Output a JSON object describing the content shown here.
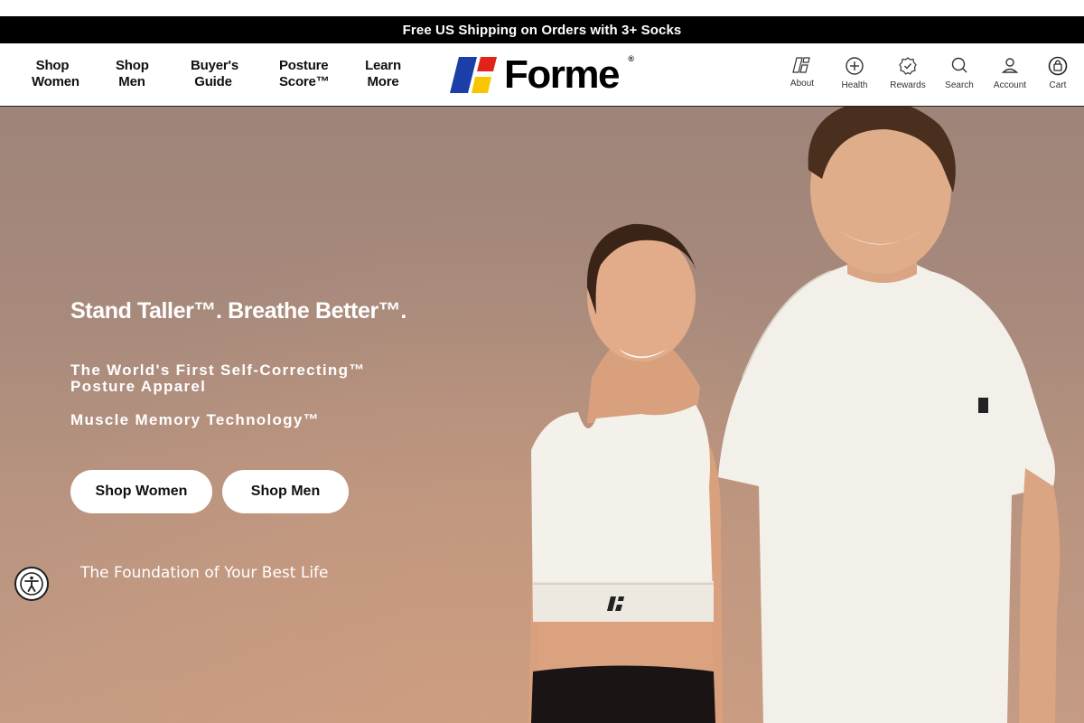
{
  "promo": {
    "text": "Free US Shipping on Orders with 3+ Socks"
  },
  "nav": {
    "links": [
      {
        "line1": "Shop",
        "line2": "Women"
      },
      {
        "line1": "Shop",
        "line2": "Men"
      },
      {
        "line1": "Buyer's",
        "line2": "Guide"
      },
      {
        "line1": "Posture",
        "line2": "Score™"
      },
      {
        "line1": "Learn",
        "line2": "More"
      }
    ],
    "utility": [
      {
        "label": "About",
        "icon": "forme-mark-icon"
      },
      {
        "label": "Health",
        "icon": "plus-circle-icon"
      },
      {
        "label": "Rewards",
        "icon": "badge-check-icon"
      },
      {
        "label": "Search",
        "icon": "search-icon"
      },
      {
        "label": "Account",
        "icon": "user-icon"
      },
      {
        "label": "Cart",
        "icon": "bag-icon"
      }
    ]
  },
  "brand": {
    "name": "Forme",
    "reg": "®",
    "colors": {
      "blue": "#1b3fa6",
      "red": "#e2231a",
      "yellow": "#f7c600"
    }
  },
  "hero": {
    "headline": "Stand Taller™. Breathe Better™.",
    "sub_line1": "The World's First Self-Correcting™",
    "sub_line2": "Posture Apparel",
    "sub_line3": "Muscle Memory Technology™",
    "btn_women": "Shop Women",
    "btn_men": "Shop Men",
    "tagline": "The Foundation of Your Best Life"
  }
}
